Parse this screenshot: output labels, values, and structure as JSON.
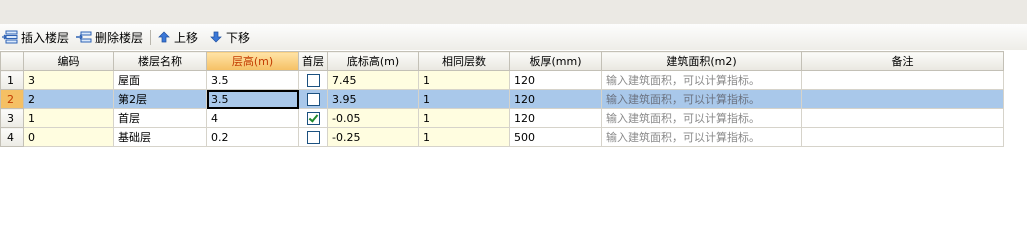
{
  "toolbar": {
    "insert_label": "插入楼层",
    "delete_label": "删除楼层",
    "up_label": "上移",
    "down_label": "下移"
  },
  "grid": {
    "columns": [
      "编码",
      "楼层名称",
      "层高(m)",
      "首层",
      "底标高(m)",
      "相同层数",
      "板厚(mm)",
      "建筑面积(m2)",
      "备注"
    ],
    "rows": [
      {
        "num": "1",
        "code": "3",
        "name": "屋面",
        "height": "3.5",
        "first": false,
        "bottom": "7.45",
        "same": "1",
        "slab": "120",
        "area": "输入建筑面积，可以计算指标。",
        "note": ""
      },
      {
        "num": "2",
        "code": "2",
        "name": "第2层",
        "height": "3.5",
        "first": false,
        "bottom": "3.95",
        "same": "1",
        "slab": "120",
        "area": "输入建筑面积，可以计算指标。",
        "note": ""
      },
      {
        "num": "3",
        "code": "1",
        "name": "首层",
        "height": "4",
        "first": true,
        "bottom": "-0.05",
        "same": "1",
        "slab": "120",
        "area": "输入建筑面积，可以计算指标。",
        "note": ""
      },
      {
        "num": "4",
        "code": "0",
        "name": "基础层",
        "height": "0.2",
        "first": false,
        "bottom": "-0.25",
        "same": "1",
        "slab": "500",
        "area": "输入建筑面积，可以计算指标。",
        "note": ""
      }
    ]
  },
  "colors": {
    "header_highlight": "#f5c064",
    "selection": "#a9c8ea",
    "editable_cell": "#fffde0"
  },
  "icons": [
    "insert-floor-icon",
    "delete-floor-icon",
    "move-up-icon",
    "move-down-icon"
  ]
}
